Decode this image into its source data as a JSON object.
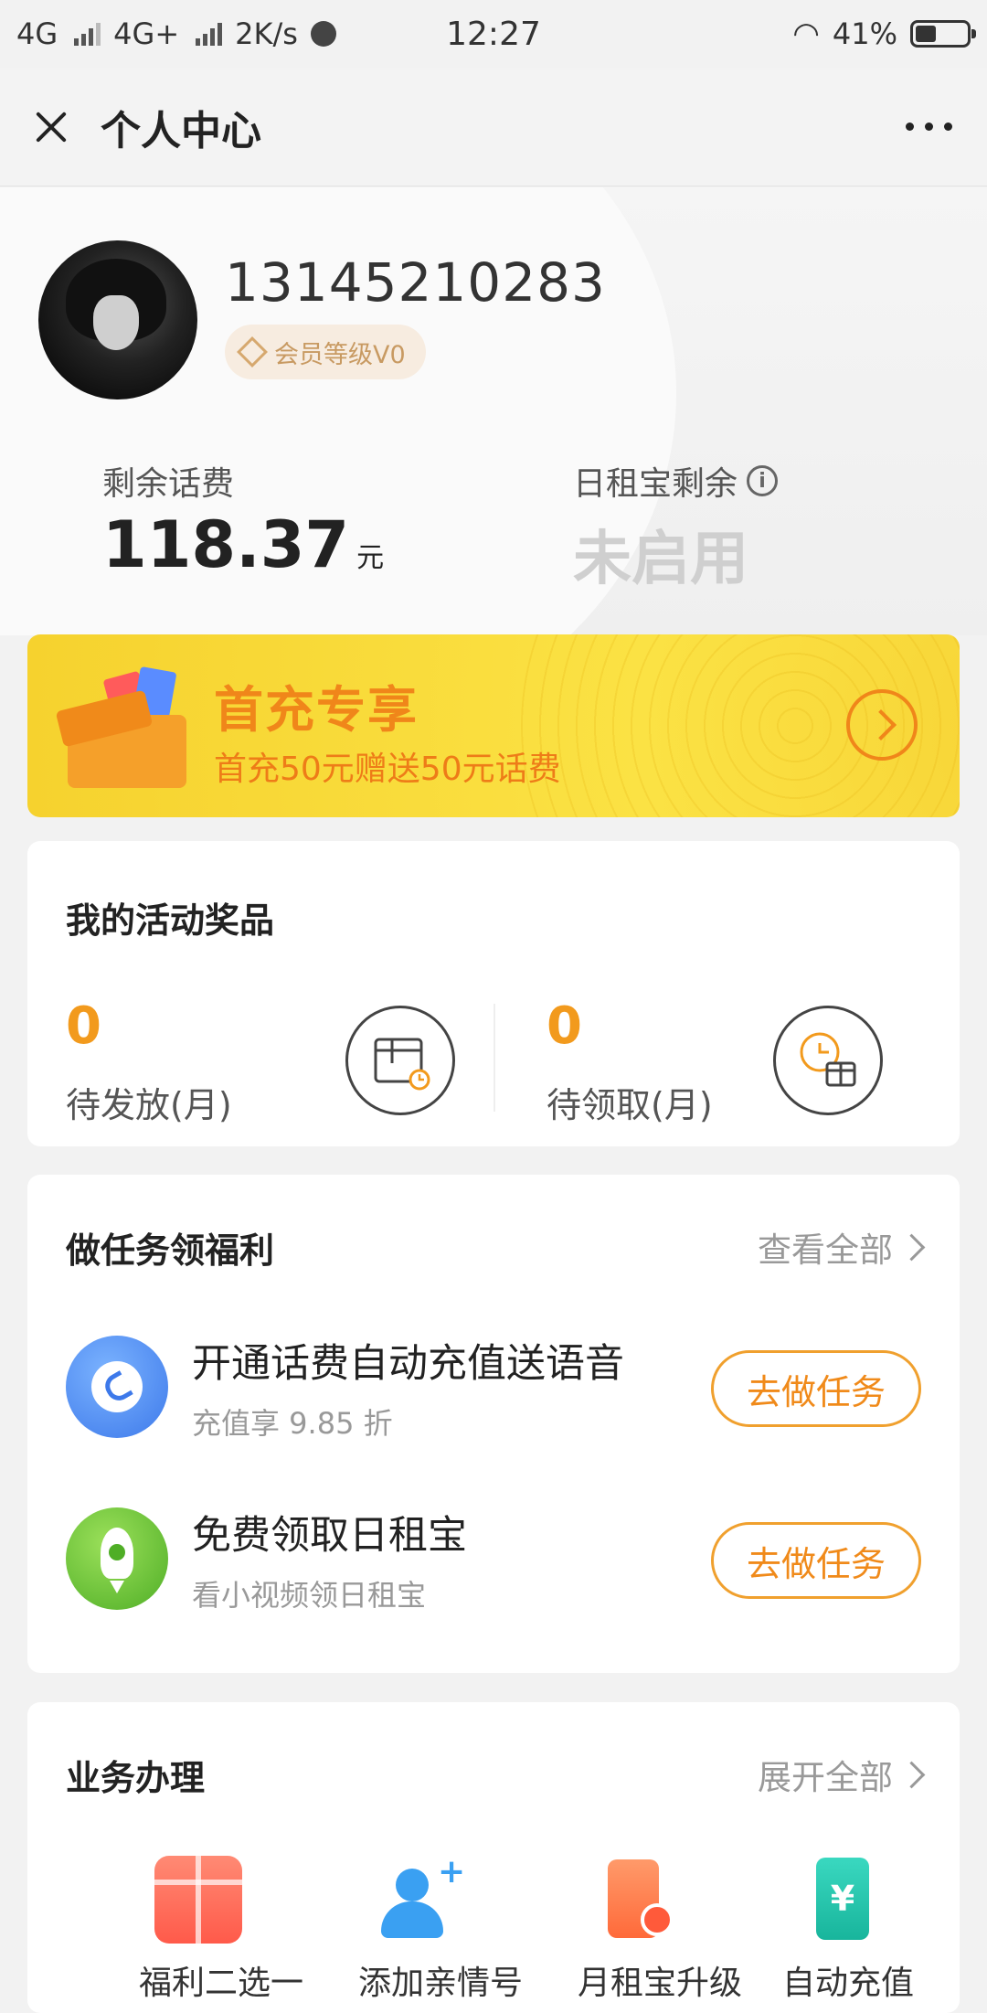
{
  "status_bar": {
    "network1": "4G",
    "network2": "4G+",
    "speed": "2K/s",
    "time": "12:27",
    "battery_pct": "41%",
    "battery_level": 0.41
  },
  "nav": {
    "title": "个人中心"
  },
  "profile": {
    "phone": "13145210283",
    "vip_level": "会员等级V0",
    "balance_label": "剩余话费",
    "balance_value": "118.37",
    "balance_unit": "元",
    "rzb_label": "日租宝剩余",
    "rzb_value": "未启用"
  },
  "promo": {
    "title": "首充专享",
    "subtitle": "首充50元赠送50元话费"
  },
  "rewards": {
    "title": "我的活动奖品",
    "pending_send_count": "0",
    "pending_send_label": "待发放(月)",
    "pending_claim_count": "0",
    "pending_claim_label": "待领取(月)"
  },
  "tasks": {
    "title": "做任务领福利",
    "view_all": "查看全部",
    "items": [
      {
        "title": "开通话费自动充值送语音",
        "subtitle": "充值享 9.85 折",
        "button": "去做任务",
        "icon": "phone-call-icon",
        "color": "#4a8cf7"
      },
      {
        "title": "免费领取日租宝",
        "subtitle": "看小视频领日租宝",
        "button": "去做任务",
        "icon": "rocket-icon",
        "color": "#6cc43c"
      }
    ]
  },
  "services": {
    "title": "业务办理",
    "expand_all": "展开全部",
    "items": [
      {
        "label": "福利二选一",
        "icon": "gift-icon",
        "color": "#ff6a5a"
      },
      {
        "label": "添加亲情号",
        "icon": "add-user-icon",
        "color": "#3aa0f2"
      },
      {
        "label": "月租宝升级",
        "icon": "phone-clock-icon",
        "color": "#ff7a4a"
      },
      {
        "label": "自动充值",
        "icon": "yuan-phone-icon",
        "color": "#22c1a8"
      }
    ]
  }
}
